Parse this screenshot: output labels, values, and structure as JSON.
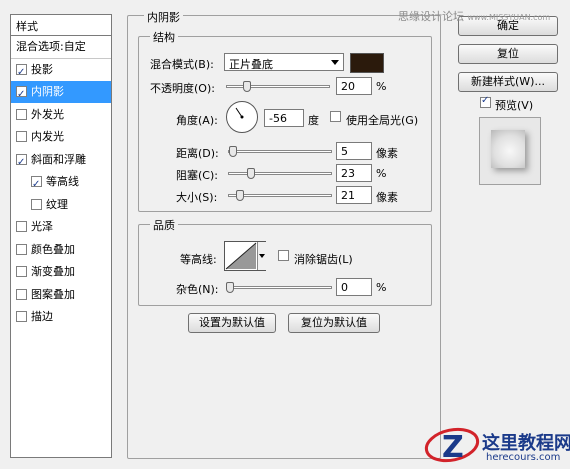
{
  "styles_panel": {
    "header": "样式",
    "items": [
      {
        "label": "混合选项:自定",
        "checkbox": false,
        "checked": false,
        "selected": false
      },
      {
        "label": "投影",
        "checkbox": true,
        "checked": true,
        "selected": false
      },
      {
        "label": "内阴影",
        "checkbox": true,
        "checked": true,
        "selected": true
      },
      {
        "label": "外发光",
        "checkbox": true,
        "checked": false,
        "selected": false
      },
      {
        "label": "内发光",
        "checkbox": true,
        "checked": false,
        "selected": false
      },
      {
        "label": "斜面和浮雕",
        "checkbox": true,
        "checked": true,
        "selected": false
      },
      {
        "label": "等高线",
        "checkbox": true,
        "checked": true,
        "selected": false,
        "indent": true
      },
      {
        "label": "纹理",
        "checkbox": true,
        "checked": false,
        "selected": false,
        "indent": true
      },
      {
        "label": "光泽",
        "checkbox": true,
        "checked": false,
        "selected": false
      },
      {
        "label": "颜色叠加",
        "checkbox": true,
        "checked": false,
        "selected": false
      },
      {
        "label": "渐变叠加",
        "checkbox": true,
        "checked": false,
        "selected": false
      },
      {
        "label": "图案叠加",
        "checkbox": true,
        "checked": false,
        "selected": false
      },
      {
        "label": "描边",
        "checkbox": true,
        "checked": false,
        "selected": false
      }
    ]
  },
  "inner_shadow": {
    "title": "内阴影",
    "structure": {
      "title": "结构",
      "blend_mode_label": "混合模式(B):",
      "blend_mode_value": "正片叠底",
      "blend_color": "#2b1a0c",
      "opacity_label": "不透明度(O):",
      "opacity_value": "20",
      "opacity_unit": "%",
      "angle_label": "角度(A):",
      "angle_value": "-56",
      "angle_unit": "度",
      "global_light_label": "使用全局光(G)",
      "global_light_checked": false,
      "distance_label": "距离(D):",
      "distance_value": "5",
      "distance_unit": "像素",
      "choke_label": "阻塞(C):",
      "choke_value": "23",
      "choke_unit": "%",
      "size_label": "大小(S):",
      "size_value": "21",
      "size_unit": "像素"
    },
    "quality": {
      "title": "品质",
      "contour_label": "等高线:",
      "anti_alias_label": "消除锯齿(L)",
      "anti_alias_checked": false,
      "noise_label": "杂色(N):",
      "noise_value": "0",
      "noise_unit": "%"
    },
    "set_default_label": "设置为默认值",
    "reset_default_label": "复位为默认值"
  },
  "right_buttons": {
    "ok_label": "确定",
    "reset_label": "复位",
    "new_style_label": "新建样式(W)...",
    "preview_label": "预览(V)",
    "preview_checked": true
  },
  "watermarks": {
    "top": "思缘设计论坛",
    "top_url": "www.MISSYUAN.com",
    "logo_title": "这里教程网",
    "logo_url": "herecours.com"
  },
  "colors": {
    "selection": "#3399ff",
    "logo_blue": "#1b3a8a",
    "logo_red": "#d2232a"
  }
}
